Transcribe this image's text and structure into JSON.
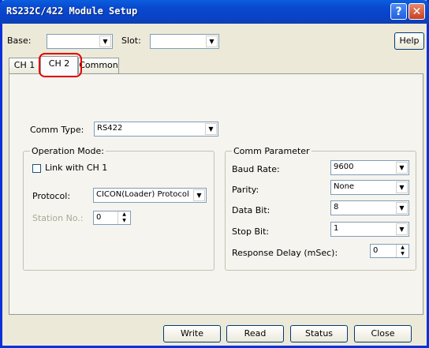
{
  "window": {
    "title": "RS232C/422 Module Setup"
  },
  "header": {
    "base_label": "Base:",
    "base_value": "",
    "slot_label": "Slot:",
    "slot_value": "",
    "help_label": "Help"
  },
  "tabs": [
    {
      "label": "CH 1"
    },
    {
      "label": "CH 2"
    },
    {
      "label": "Common"
    }
  ],
  "comm_type": {
    "label": "Comm Type:",
    "value": "RS422"
  },
  "operation_mode": {
    "title": "Operation Mode:",
    "link_label": "Link with CH 1",
    "link_checked": false,
    "protocol_label": "Protocol:",
    "protocol_value": "CICON(Loader) Protocol",
    "station_label": "Station No.:",
    "station_value": "0"
  },
  "comm_parameter": {
    "title": "Comm Parameter",
    "baud_label": "Baud Rate:",
    "baud_value": "9600",
    "parity_label": "Parity:",
    "parity_value": "None",
    "databit_label": "Data Bit:",
    "databit_value": "8",
    "stopbit_label": "Stop Bit:",
    "stopbit_value": "1",
    "delay_label": "Response Delay (mSec):",
    "delay_value": "0"
  },
  "footer": {
    "write": "Write",
    "read": "Read",
    "status": "Status",
    "close": "Close"
  },
  "colors": {
    "title_bar": "#0a4ad0",
    "highlight": "#e30000",
    "face": "#ece9d8"
  }
}
